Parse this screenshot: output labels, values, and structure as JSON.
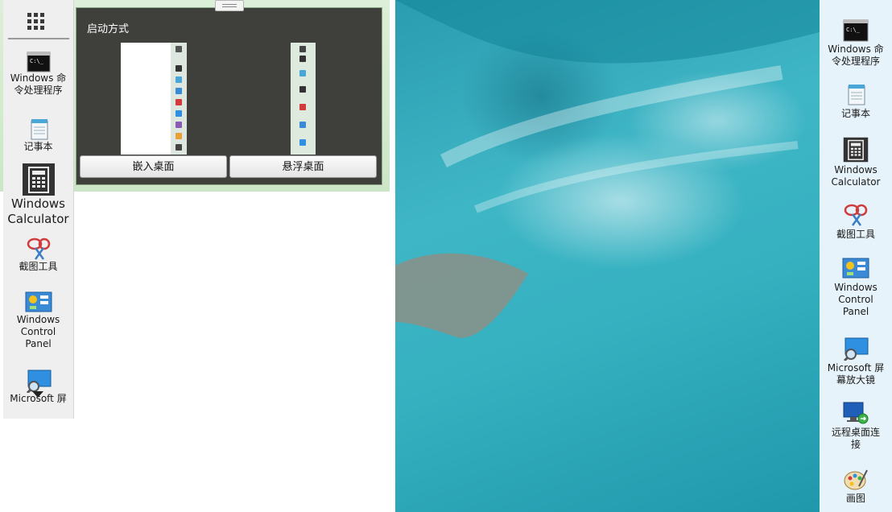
{
  "left_strip": {
    "apps": [
      {
        "label": "Windows 命\n令处理程序"
      },
      {
        "label": "记事本"
      },
      {
        "label": "Windows\nCalculator"
      },
      {
        "label": "截图工具"
      },
      {
        "label": "Windows\nControl\nPanel"
      },
      {
        "label": "Microsoft 屏"
      }
    ]
  },
  "popup": {
    "title": "启动方式",
    "embed_label": "嵌入桌面",
    "float_label": "悬浮桌面"
  },
  "right_strip": {
    "apps": [
      {
        "label": "Windows 命\n令处理程序"
      },
      {
        "label": "记事本"
      },
      {
        "label": "Windows\nCalculator"
      },
      {
        "label": "截图工具"
      },
      {
        "label": "Windows\nControl\nPanel"
      },
      {
        "label": "Microsoft 屏\n幕放大镜"
      },
      {
        "label": "远程桌面连\n接"
      },
      {
        "label": "画图"
      }
    ]
  }
}
